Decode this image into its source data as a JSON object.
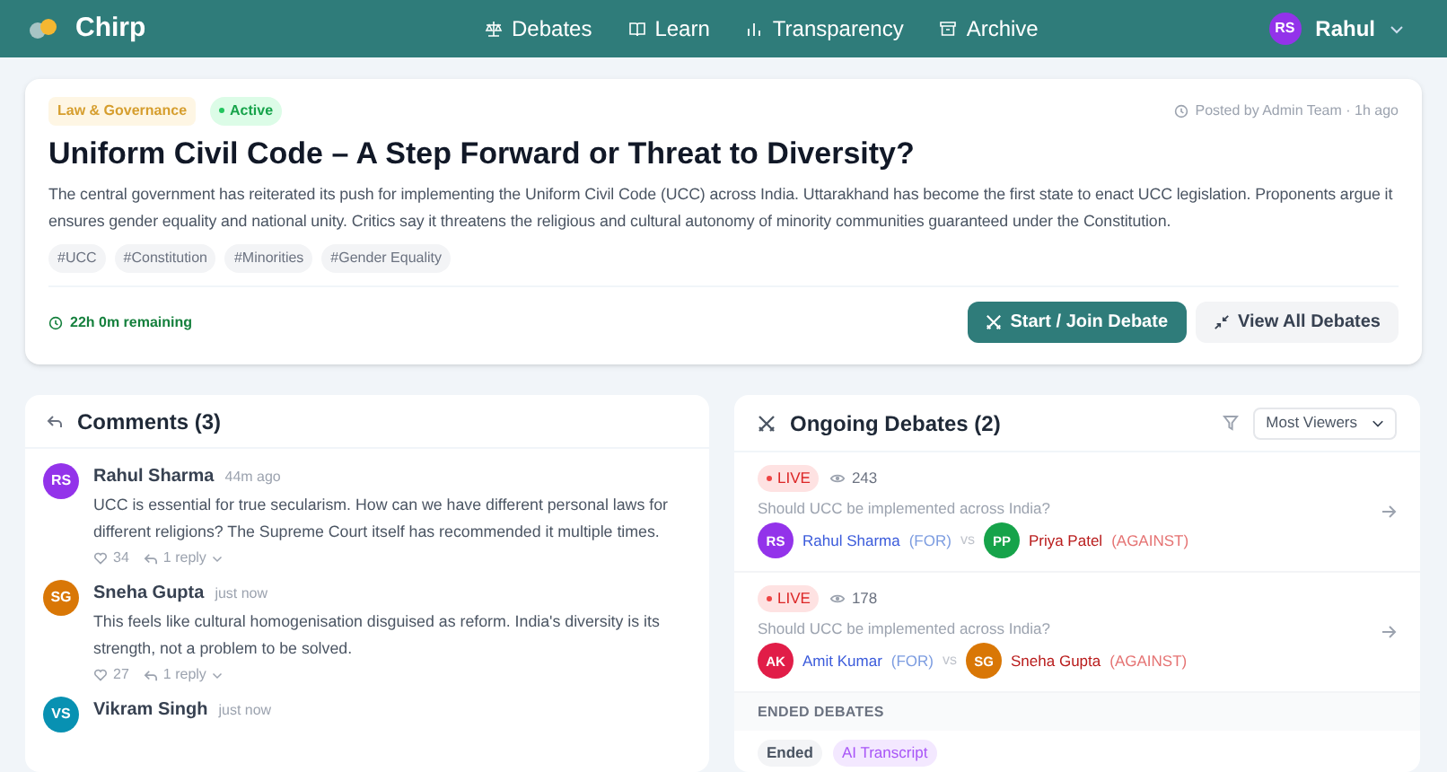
{
  "header": {
    "brand": "Chirp",
    "nav": [
      {
        "label": "Debates"
      },
      {
        "label": "Learn"
      },
      {
        "label": "Transparency"
      },
      {
        "label": "Archive"
      }
    ],
    "user": {
      "initials": "RS",
      "name": "Rahul",
      "color": "#9333ea"
    }
  },
  "topic": {
    "category": "Law & Governance",
    "status": "Active",
    "posted": "Posted by Admin Team · 1h ago",
    "title": "Uniform Civil Code – A Step Forward or Threat to Diversity?",
    "description": "The central government has reiterated its push for implementing the Uniform Civil Code (UCC) across India. Uttarakhand has become the first state to enact UCC legislation. Proponents argue it ensures gender equality and national unity. Critics say it threatens the religious and cultural autonomy of minority communities guaranteed under the Constitution.",
    "tags": [
      "#UCC",
      "#Constitution",
      "#Minorities",
      "#Gender Equality"
    ],
    "remaining": "22h 0m remaining",
    "buttons": [
      {
        "label": "Start / Join Debate",
        "kind": "primary"
      },
      {
        "label": "View All Debates",
        "kind": "secondary"
      }
    ]
  },
  "comments": {
    "title": "Comments (3)",
    "items": [
      {
        "initials": "RS",
        "color": "#9333ea",
        "author": "Rahul Sharma",
        "time": "44m ago",
        "text": "UCC is essential for true secularism. How can we have different personal laws for different religions? The Supreme Court itself has recommended it multiple times.",
        "likes": "34",
        "replies": "1 reply"
      },
      {
        "initials": "SG",
        "color": "#d97706",
        "author": "Sneha Gupta",
        "time": "just now",
        "text": "This feels like cultural homogenisation disguised as reform. India's diversity is its strength, not a problem to be solved.",
        "likes": "27",
        "replies": "1 reply"
      },
      {
        "initials": "VS",
        "color": "#0891b2",
        "author": "Vikram Singh",
        "time": "just now"
      }
    ]
  },
  "debates": {
    "title": "Ongoing Debates (2)",
    "sort": "Most Viewers",
    "ongoing": [
      {
        "status": "LIVE",
        "viewers": "243",
        "question": "Should UCC be implemented across India?",
        "for": {
          "initials": "RS",
          "color": "#9333ea",
          "name": "Rahul Sharma",
          "side": "(FOR)"
        },
        "vs": "vs",
        "against": {
          "initials": "PP",
          "color": "#16a34a",
          "name": "Priya Patel",
          "side": "(AGAINST)"
        }
      },
      {
        "status": "LIVE",
        "viewers": "178",
        "question": "Should UCC be implemented across India?",
        "for": {
          "initials": "AK",
          "color": "#e11d48",
          "name": "Amit Kumar",
          "side": "(FOR)"
        },
        "vs": "vs",
        "against": {
          "initials": "SG",
          "color": "#d97706",
          "name": "Sneha Gupta",
          "side": "(AGAINST)"
        }
      }
    ],
    "ended_heading": "ENDED DEBATES",
    "ended": [
      {
        "status": "Ended",
        "badge": "AI Transcript"
      }
    ]
  }
}
